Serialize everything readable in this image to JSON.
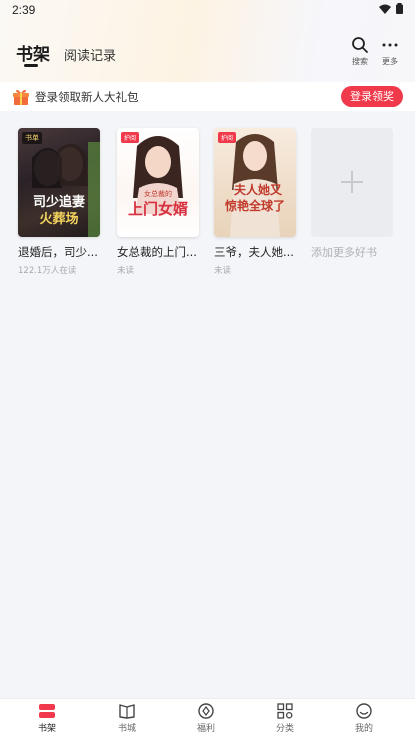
{
  "status_bar": {
    "time": "2:39"
  },
  "header": {
    "tabs": [
      {
        "label": "书架",
        "active": true
      },
      {
        "label": "阅读记录",
        "active": false
      }
    ],
    "actions": [
      {
        "label": "搜索",
        "icon": "search-icon"
      },
      {
        "label": "更多",
        "icon": "more-icon"
      }
    ]
  },
  "promo": {
    "text": "登录领取新人大礼包",
    "button": "登录领奖",
    "accent": "#f0394a"
  },
  "books": [
    {
      "title": "退婚后，司少...",
      "status": "122.1万人在读",
      "cover_text": "司少追妻火葬场",
      "badge": "书单"
    },
    {
      "title": "女总裁的上门...",
      "status": "未读",
      "cover_text": "上门女婿",
      "badge": "护阅"
    },
    {
      "title": "三爷，夫人她...",
      "status": "未读",
      "cover_text": "夫人她又惊艳全球了",
      "badge": "护阅"
    }
  ],
  "add_more": {
    "label": "添加更多好书"
  },
  "bottom_nav": [
    {
      "label": "书架",
      "icon": "bookshelf-icon",
      "active": true
    },
    {
      "label": "书城",
      "icon": "book-icon",
      "active": false
    },
    {
      "label": "福利",
      "icon": "coin-icon",
      "active": false
    },
    {
      "label": "分类",
      "icon": "grid-icon",
      "active": false
    },
    {
      "label": "我的",
      "icon": "profile-icon",
      "active": false
    }
  ]
}
